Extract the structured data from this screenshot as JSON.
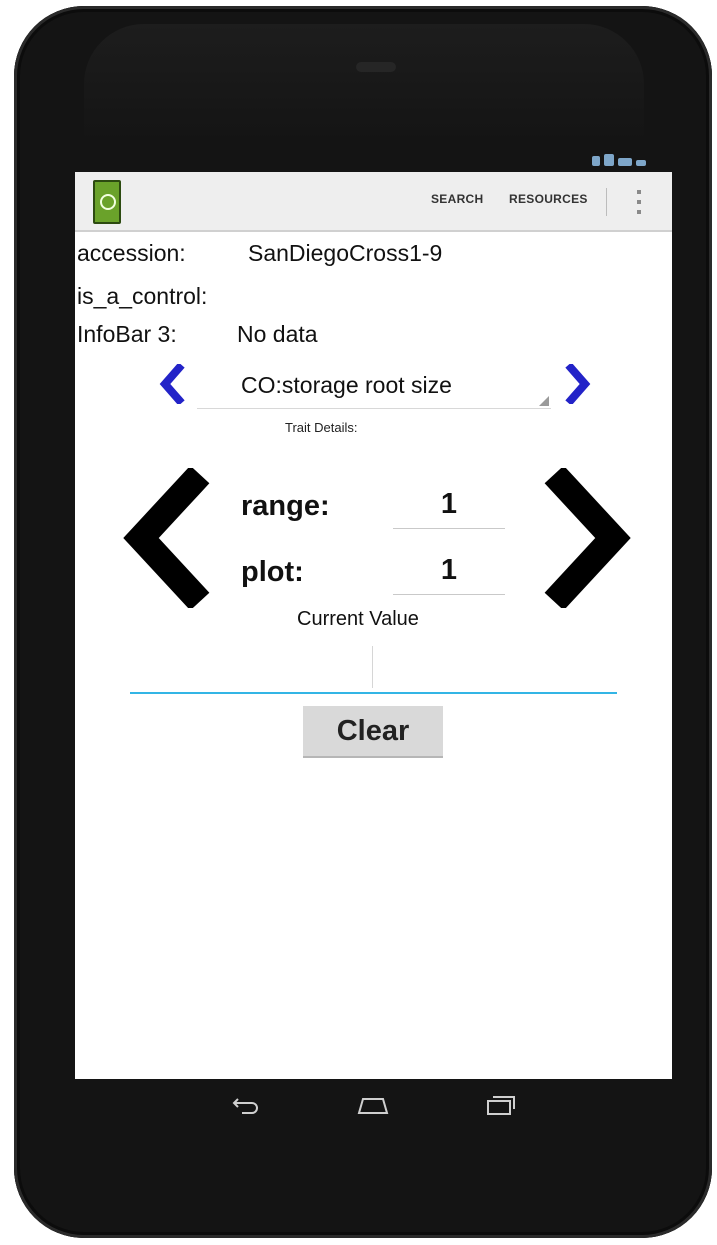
{
  "action_bar": {
    "search_label": "SEARCH",
    "resources_label": "RESOURCES"
  },
  "info_bars": [
    {
      "label": "accession:",
      "value": "SanDiegoCross1-9"
    },
    {
      "label": "is_a_control:",
      "value": ""
    },
    {
      "label": "InfoBar 3:",
      "value": "No data"
    }
  ],
  "trait": {
    "selected": "CO:storage root size",
    "details_label": "Trait Details:"
  },
  "plot_fields": [
    {
      "label": "range:",
      "value": "1"
    },
    {
      "label": "plot:",
      "value": "1"
    }
  ],
  "current_value": {
    "label": "Current Value",
    "value": ""
  },
  "clear_label": "Clear",
  "colors": {
    "accent_blue_arrow": "#2323c8",
    "input_underline": "#33b5e5",
    "app_icon_green": "#6aa22a"
  },
  "icons": {
    "app": "app-logo-icon",
    "overflow": "overflow-menu-icon",
    "trait_prev": "chevron-left-icon",
    "trait_next": "chevron-right-icon",
    "plot_prev": "large-chevron-left-icon",
    "plot_next": "large-chevron-right-icon",
    "nav_back": "back-icon",
    "nav_home": "home-icon",
    "nav_recents": "recents-icon"
  }
}
